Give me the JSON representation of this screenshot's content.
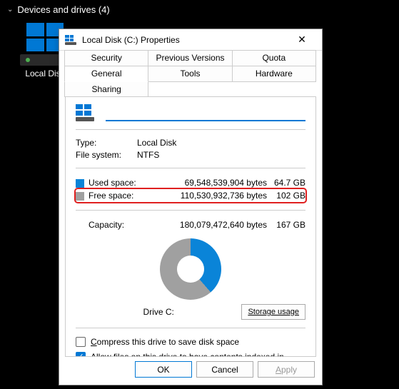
{
  "explorer": {
    "section_title": "Devices and drives (4)",
    "drive_label": "Local Disk"
  },
  "dialog": {
    "title": "Local Disk (C:) Properties",
    "tabs": {
      "security": "Security",
      "previous": "Previous Versions",
      "quota": "Quota",
      "general": "General",
      "tools": "Tools",
      "hardware": "Hardware",
      "sharing": "Sharing"
    },
    "name_value": "",
    "type_label": "Type:",
    "type_value": "Local Disk",
    "fs_label": "File system:",
    "fs_value": "NTFS",
    "used_label": "Used space:",
    "used_bytes": "69,548,539,904 bytes",
    "used_gb": "64.7 GB",
    "free_label": "Free space:",
    "free_bytes": "110,530,932,736 bytes",
    "free_gb": "102 GB",
    "capacity_label": "Capacity:",
    "capacity_bytes": "180,079,472,640 bytes",
    "capacity_gb": "167 GB",
    "drive_c": "Drive C:",
    "storage_usage": "Storage usage",
    "compress_prefix": "C",
    "compress_rest": "ompress this drive to save disk space",
    "index_text": "Allow files on this drive to have contents indexed in addition to file properties",
    "ok": "OK",
    "cancel": "Cancel",
    "apply_prefix": "A",
    "apply_rest": "pply"
  }
}
